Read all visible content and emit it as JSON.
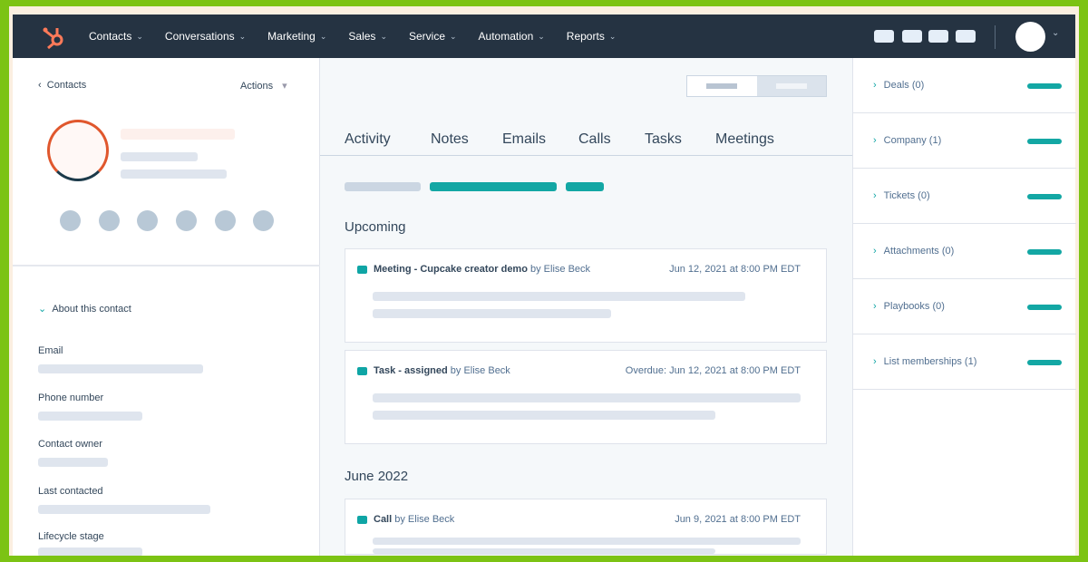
{
  "nav": {
    "items": [
      "Contacts",
      "Conversations",
      "Marketing",
      "Sales",
      "Service",
      "Automation",
      "Reports"
    ]
  },
  "left": {
    "back": "Contacts",
    "actions": "Actions",
    "section": "About this contact",
    "fields": [
      "Email",
      "Phone number",
      "Contact owner",
      "Last contacted",
      "Lifecycle stage"
    ]
  },
  "mid": {
    "tabs": [
      "Activity",
      "Notes",
      "Emails",
      "Calls",
      "Tasks",
      "Meetings"
    ],
    "upcoming": "Upcoming",
    "month": "June 2022",
    "cards": [
      {
        "type": "Meeting - Cupcake creator demo",
        "by": "by Elise Beck",
        "date": "Jun 12, 2021 at 8:00 PM EDT",
        "overdue": false
      },
      {
        "type": "Task - assigned",
        "by": "by Elise Beck",
        "date": "Overdue: Jun 12, 2021 at 8:00 PM EDT",
        "overdue": true
      },
      {
        "type": "Call",
        "by": "by Elise Beck",
        "date": "Jun 9, 2021 at 8:00 PM EDT",
        "overdue": false
      }
    ]
  },
  "right": {
    "items": [
      "Deals (0)",
      "Company (1)",
      "Tickets (0)",
      "Attachments (0)",
      "Playbooks (0)",
      "List memberships (1)"
    ]
  },
  "colors": {
    "accent": "#0fa5a5",
    "nav": "#253342",
    "border": "#7cc314"
  }
}
